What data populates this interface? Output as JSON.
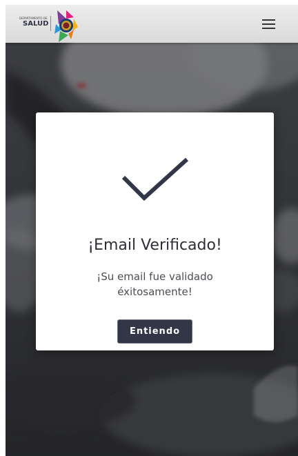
{
  "header": {
    "logo": {
      "small_text": "DEPARTAMENTO DE",
      "main_text": "SALUD",
      "colors": [
        "#2b9ad6",
        "#e0237a",
        "#7e3f98",
        "#f2b31b",
        "#3aa855",
        "#1d3b6d"
      ]
    },
    "menu_icon": "hamburger-menu-icon"
  },
  "background": {
    "description_color": "#3a3c40"
  },
  "modal": {
    "icon": "check-icon",
    "title": "¡Email Verificado!",
    "message_line1": "¡Su email fue validado",
    "message_line2": "éxitosamente!",
    "confirm_label": "Entiendo",
    "accent_color": "#323646"
  }
}
